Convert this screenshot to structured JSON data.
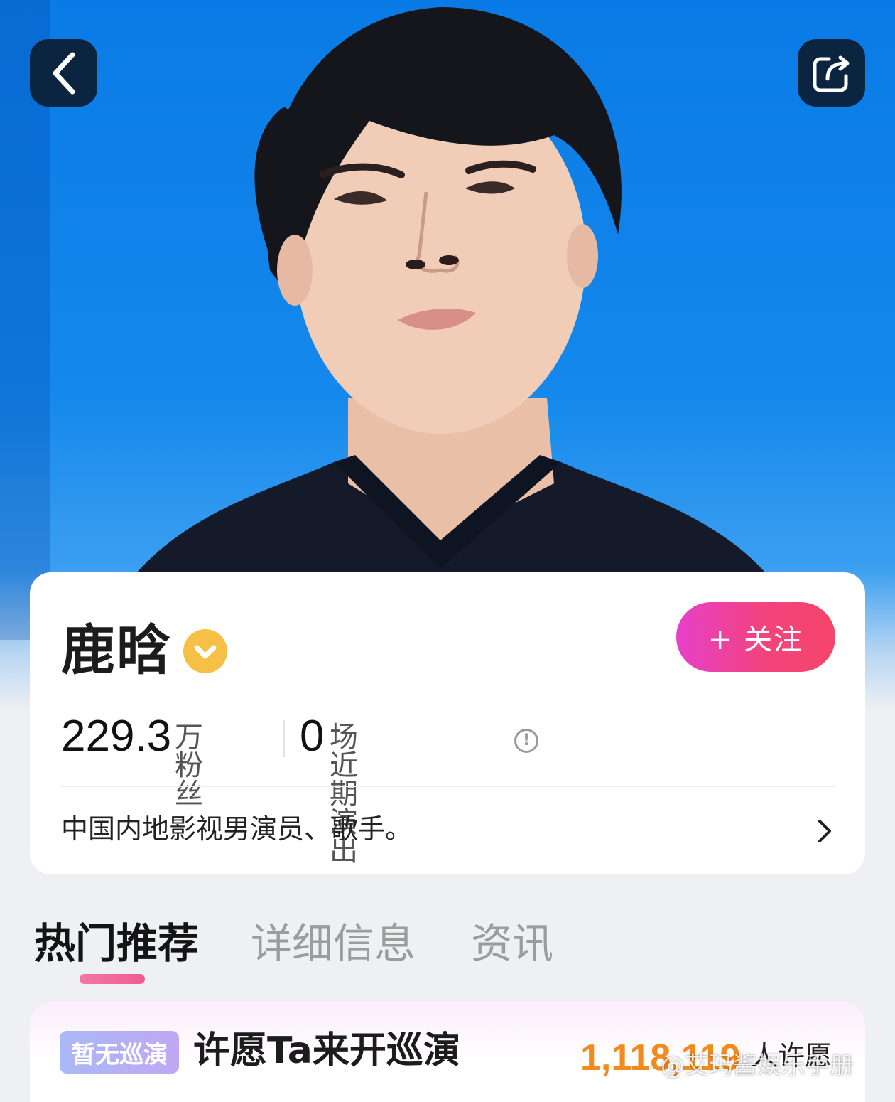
{
  "artist": {
    "name": "鹿晗",
    "fans_count": "229.3",
    "fans_label": "万粉丝",
    "shows_count": "0",
    "shows_label": "场近期演出",
    "bio": "中国内地影视男演员、歌手。"
  },
  "actions": {
    "follow_label": "+ 关注"
  },
  "tabs": [
    {
      "label": "热门推荐",
      "active": true
    },
    {
      "label": "详细信息",
      "active": false
    },
    {
      "label": "资讯",
      "active": false
    }
  ],
  "tour": {
    "badge": "暂无巡演",
    "title": "许愿Ta来开巡演",
    "wish_count": "1,118,119",
    "wish_label": "人许愿"
  },
  "watermark": "@艾玛酱娱乐手册",
  "colors": {
    "hero_blue": "#0a7be6",
    "follow_start": "#e640c8",
    "follow_end": "#f5456a",
    "wish_orange": "#f48a1c",
    "verified_gold": "#f5c043"
  },
  "icons": [
    "back-arrow-icon",
    "share-icon",
    "verified-icon",
    "info-icon",
    "chevron-right-icon"
  ]
}
